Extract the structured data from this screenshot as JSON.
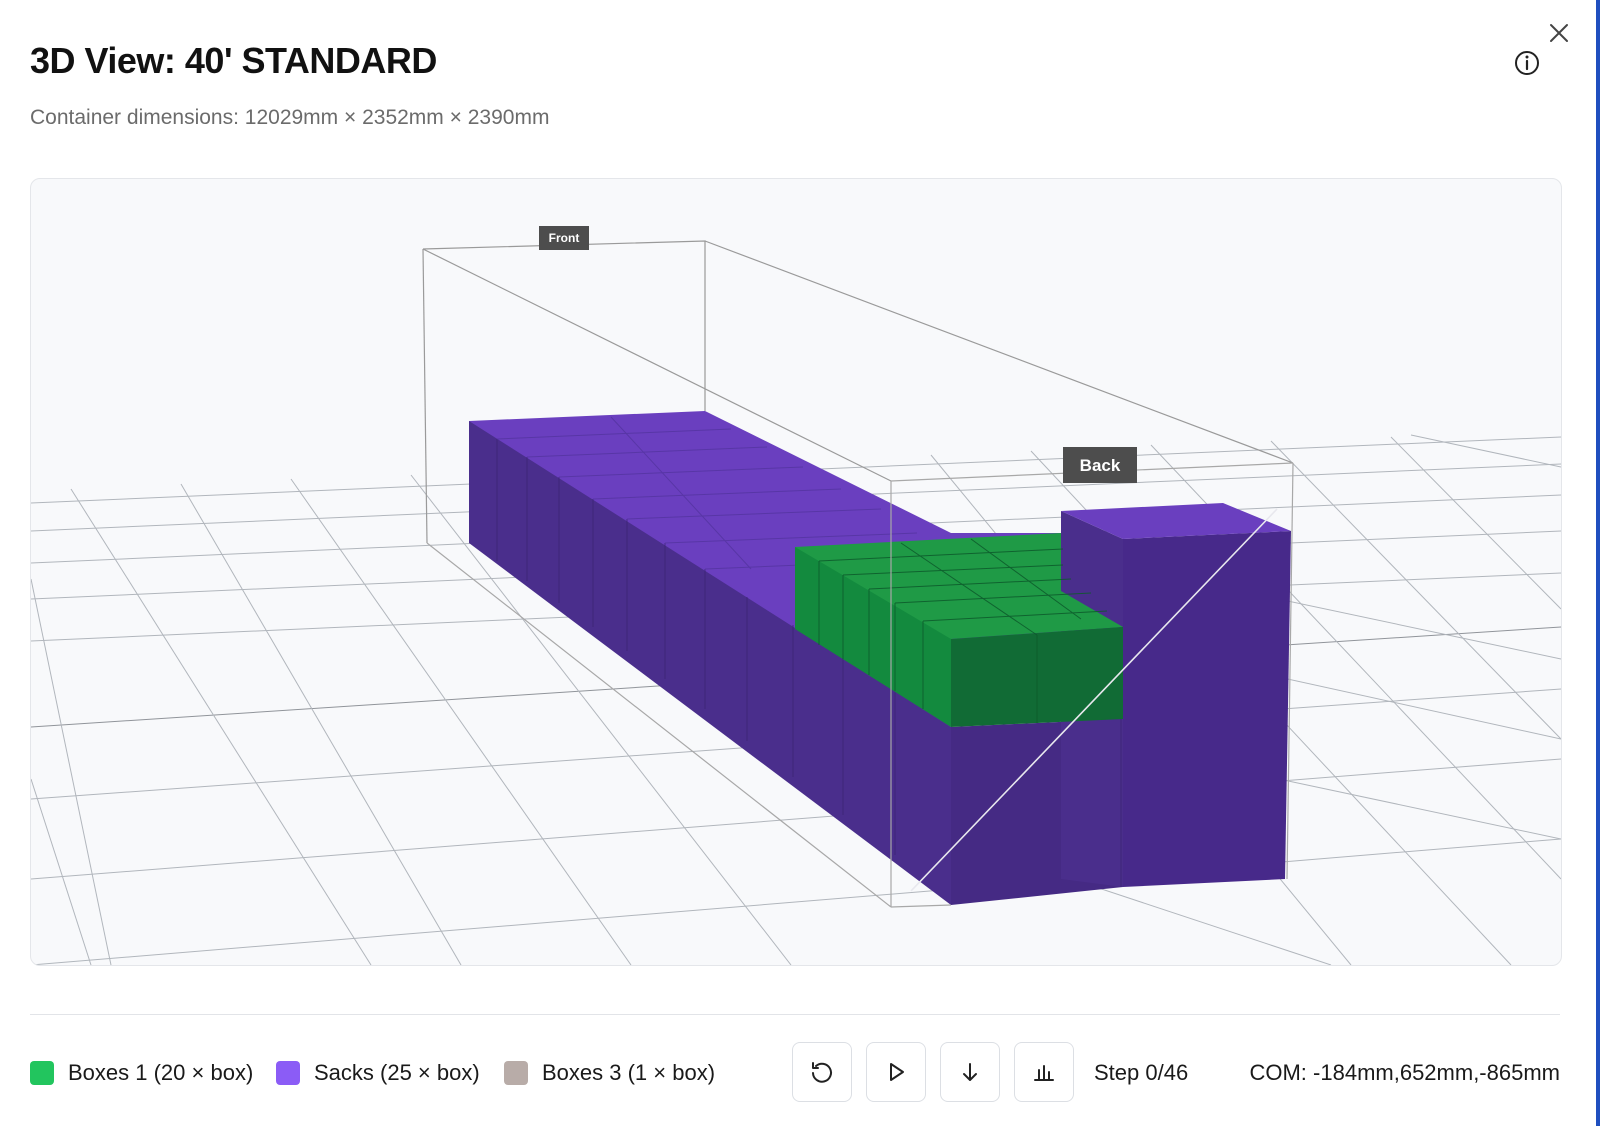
{
  "dialog": {
    "title": "3D View: 40' STANDARD",
    "subtitle": "Container dimensions: 12029mm × 2352mm × 2390mm"
  },
  "scene": {
    "front_label": "Front",
    "back_label": "Back",
    "colors": {
      "sacks_top": "#6a3fbf",
      "sacks_side": "#4a2e8c",
      "boxes_top": "#1f9a46",
      "boxes_side": "#116b35",
      "grid": "#9aa0a8",
      "wireframe": "#9a9a9a",
      "background": "#f8f9fb"
    }
  },
  "legend": [
    {
      "label": "Boxes 1 (20 × box)",
      "color": "#22c55e"
    },
    {
      "label": "Sacks (25 × box)",
      "color": "#8b5cf6"
    },
    {
      "label": "Boxes 3 (1 × box)",
      "color": "#b8aca8"
    }
  ],
  "controls": {
    "reset_icon": "rotate-ccw-icon",
    "play_icon": "play-icon",
    "step_icon": "arrow-down-icon",
    "stats_icon": "bar-chart-icon"
  },
  "status": {
    "step": "Step 0/46",
    "com": "COM: -184mm,652mm,-865mm"
  }
}
